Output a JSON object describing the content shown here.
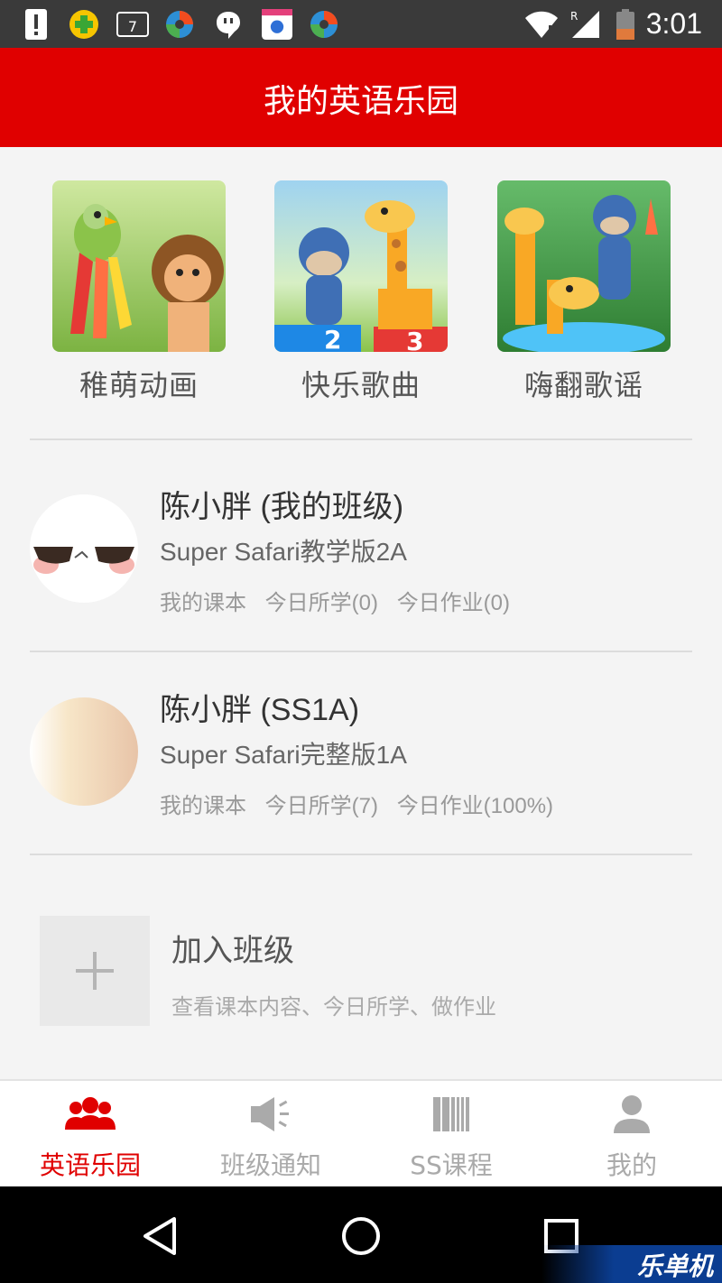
{
  "status_bar": {
    "time": "3:01",
    "icons": [
      "alert-icon",
      "plus-badge-icon",
      "calendar-icon",
      "app-icon",
      "chat-icon",
      "baidu-icon",
      "app-icon",
      "wifi-icon",
      "signal-icon",
      "battery-icon"
    ]
  },
  "header": {
    "title": "我的英语乐园"
  },
  "categories": [
    {
      "label": "稚萌动画"
    },
    {
      "label": "快乐歌曲"
    },
    {
      "label": "嗨翻歌谣"
    }
  ],
  "classes": [
    {
      "title": "陈小胖 (我的班级)",
      "book": "Super Safari教学版2A",
      "links": [
        "我的课本",
        "今日所学(0)",
        "今日作业(0)"
      ]
    },
    {
      "title": "陈小胖 (SS1A)",
      "book": "Super Safari完整版1A",
      "links": [
        "我的课本",
        "今日所学(7)",
        "今日作业(100%)"
      ]
    }
  ],
  "join": {
    "title": "加入班级",
    "subtitle": "查看课本内容、今日所学、做作业"
  },
  "tabs": [
    {
      "label": "英语乐园",
      "icon": "group-icon",
      "active": true
    },
    {
      "label": "班级通知",
      "icon": "speaker-icon",
      "active": false
    },
    {
      "label": "SS课程",
      "icon": "books-icon",
      "active": false
    },
    {
      "label": "我的",
      "icon": "person-icon",
      "active": false
    }
  ],
  "watermark": "乐单机",
  "colors": {
    "accent": "#e00000",
    "tab_inactive": "#aaaaaa",
    "background": "#f4f4f4"
  }
}
